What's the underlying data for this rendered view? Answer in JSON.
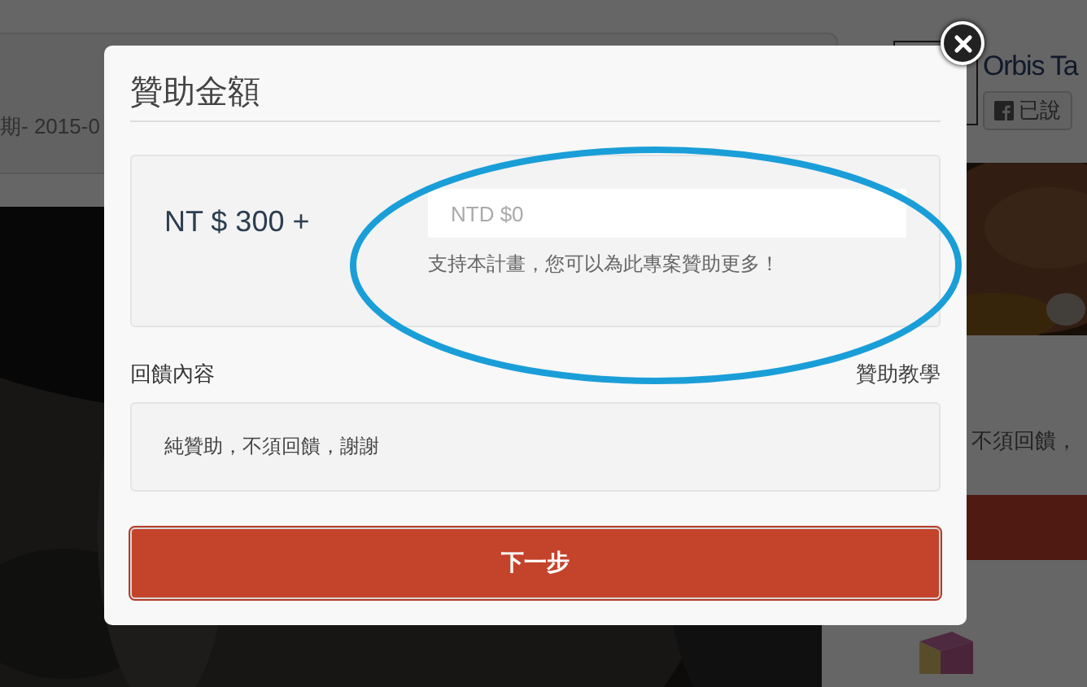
{
  "background": {
    "date_text": "期- 2015-0",
    "profile_name": "Orbis Ta",
    "share_button": "已說",
    "reward_text": "不須回饋，"
  },
  "modal": {
    "title": "贊助金額",
    "amount_label": "NT $ 300 +",
    "amount_input": {
      "placeholder": "NTD $0"
    },
    "amount_hint": "支持本計畫，您可以為此專案贊助更多！",
    "reward_heading": "回饋內容",
    "tutorial_link": "贊助教學",
    "reward_content": "純贊助，不須回饋，謝謝",
    "next_button": "下一步"
  }
}
